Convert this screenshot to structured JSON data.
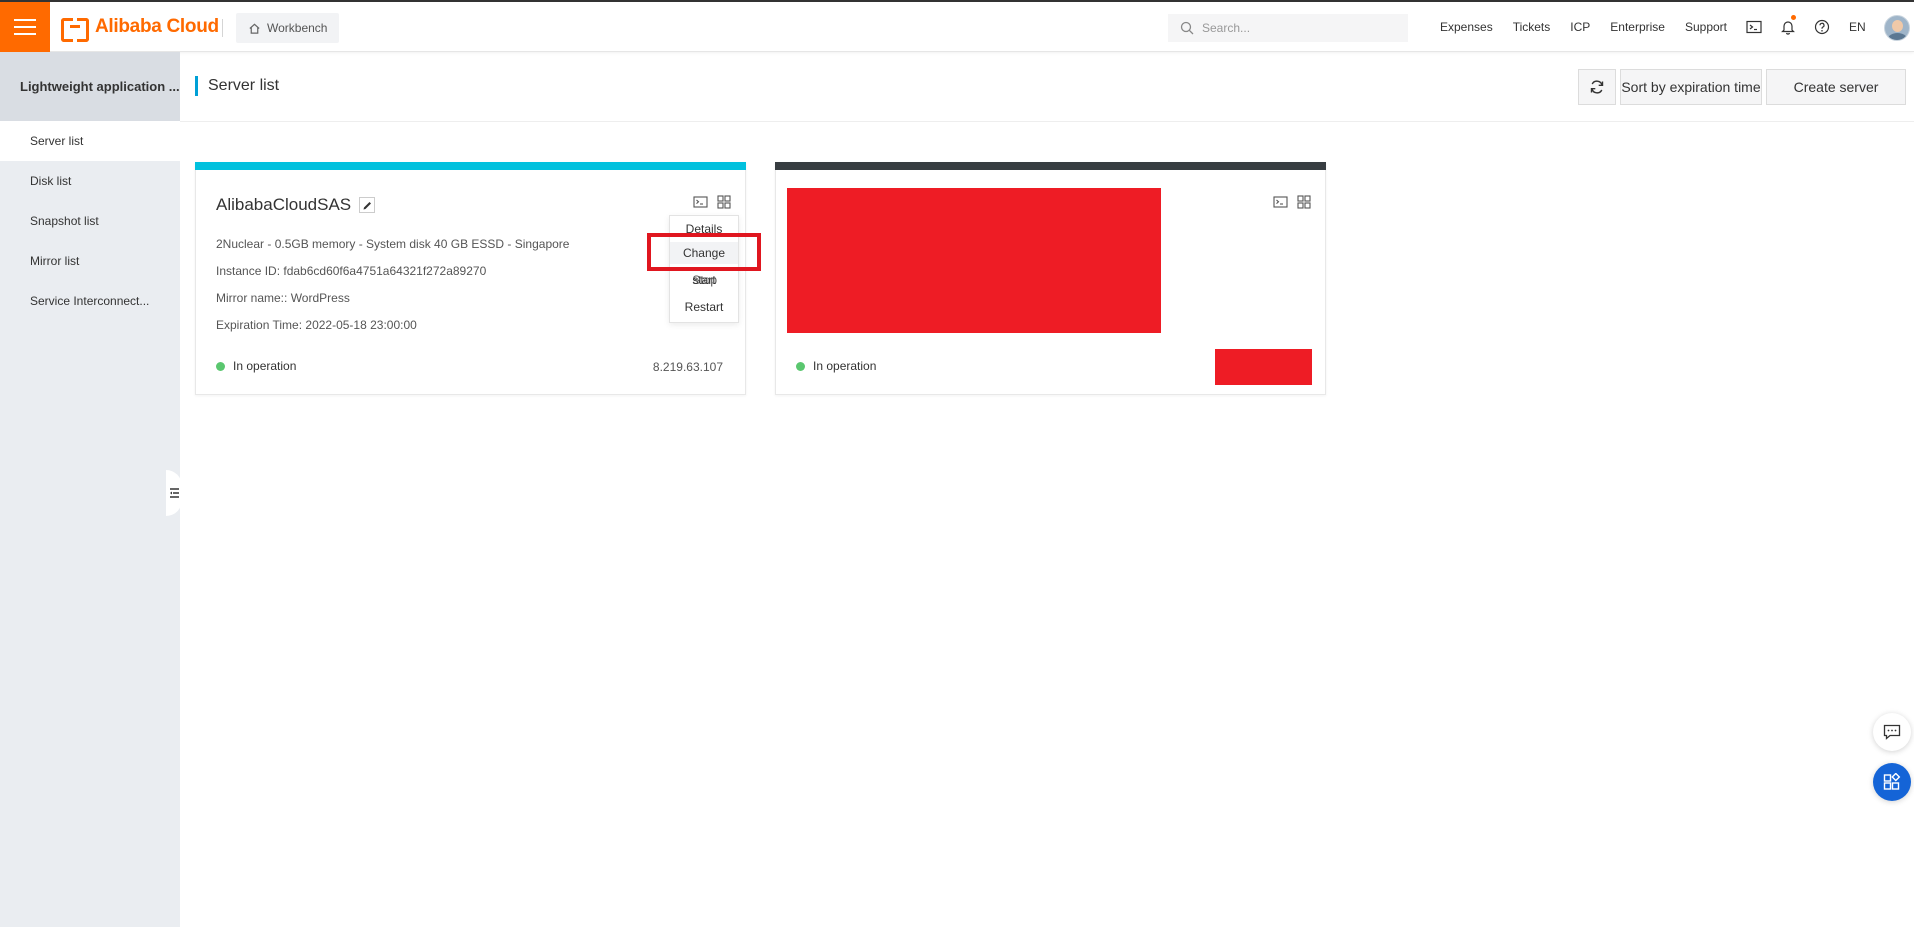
{
  "topbar": {
    "logo_text": "Alibaba Cloud",
    "workbench_label": "Workbench",
    "search_placeholder": "Search...",
    "links": [
      "Expenses",
      "Tickets",
      "ICP",
      "Enterprise",
      "Support"
    ],
    "lang": "EN"
  },
  "sidebar": {
    "title": "Lightweight application ...",
    "items": [
      {
        "label": "Server list",
        "active": true
      },
      {
        "label": "Disk list"
      },
      {
        "label": "Snapshot list"
      },
      {
        "label": "Mirror list"
      },
      {
        "label": "Service Interconnect..."
      }
    ]
  },
  "page": {
    "title": "Server list",
    "sort_label": "Sort by expiration time",
    "create_label": "Create server"
  },
  "cards": [
    {
      "name": "AlibabaCloudSAS",
      "spec": "2Nuclear - 0.5GB memory - System disk 40 GB ESSD - Singapore",
      "instance_label": "Instance ID:",
      "instance_id": "fdab6cd60f6a4751a64321f272a89270",
      "mirror_label": "Mirror name::",
      "mirror": "WordPress",
      "expiration_label": "Expiration Time:",
      "expiration": "2022-05-18 23:00:00",
      "status": "In operation",
      "ip": "8.219.63.107",
      "bar_color": "#00c1de"
    },
    {
      "status": "In operation",
      "bar_color": "#373d41"
    }
  ],
  "menu": {
    "details": "Details",
    "change": "Change",
    "stop": "Stop",
    "start": "start",
    "restart": "Restart"
  },
  "colors": {
    "brand": "#ff6a00",
    "highlight": "#e0161f",
    "redaction": "#ee1c25",
    "status_ok": "#5ac76f",
    "float_blue": "#1464d7"
  }
}
